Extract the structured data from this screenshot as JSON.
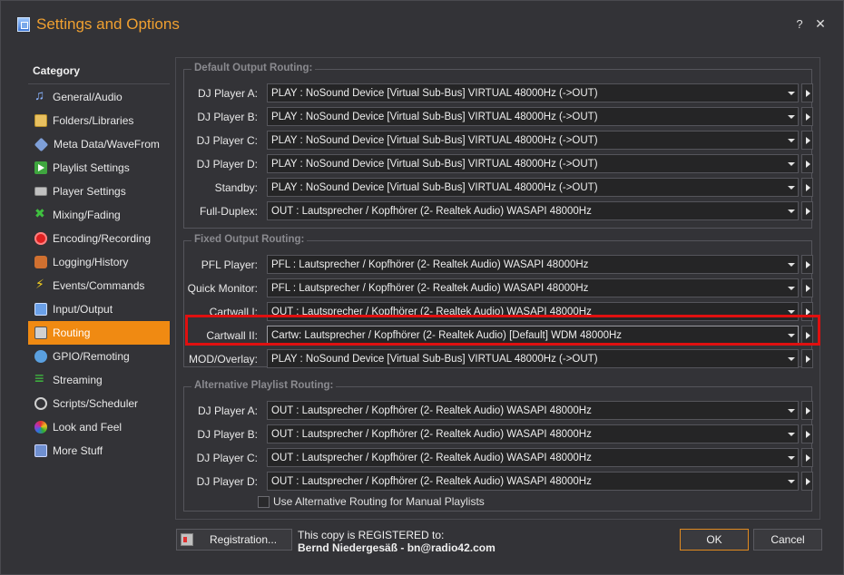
{
  "window": {
    "title": "Settings and Options",
    "help_label": "?",
    "close_label": "✕"
  },
  "sidebar": {
    "title": "Category",
    "active_index": 13,
    "items": [
      {
        "label": "General/Audio",
        "icon": "music-note-icon"
      },
      {
        "label": "Folders/Libraries",
        "icon": "folder-icon"
      },
      {
        "label": "Meta Data/WaveFrom",
        "icon": "metadata-icon"
      },
      {
        "label": "Playlist Settings",
        "icon": "playlist-icon"
      },
      {
        "label": "Player Settings",
        "icon": "player-icon"
      },
      {
        "label": "Mixing/Fading",
        "icon": "mixing-icon"
      },
      {
        "label": "Encoding/Recording",
        "icon": "record-icon"
      },
      {
        "label": "Logging/History",
        "icon": "logbook-icon"
      },
      {
        "label": "Events/Commands",
        "icon": "lightning-icon"
      },
      {
        "label": "Input/Output",
        "icon": "input-output-icon"
      },
      {
        "label": "Routing",
        "icon": "routing-icon"
      },
      {
        "label": "GPIO/Remoting",
        "icon": "gpio-icon"
      },
      {
        "label": "Streaming",
        "icon": "streaming-icon"
      },
      {
        "label": "Scripts/Scheduler",
        "icon": "clock-icon"
      },
      {
        "label": "Look and Feel",
        "icon": "palette-icon"
      },
      {
        "label": "More Stuff",
        "icon": "more-stuff-icon"
      }
    ]
  },
  "default_routing": {
    "legend": "Default Output Routing:",
    "rows": [
      {
        "label": "DJ Player A:",
        "value": "PLAY : NoSound Device [Virtual Sub-Bus] VIRTUAL 48000Hz (->OUT)"
      },
      {
        "label": "DJ Player B:",
        "value": "PLAY : NoSound Device [Virtual Sub-Bus] VIRTUAL 48000Hz (->OUT)"
      },
      {
        "label": "DJ Player C:",
        "value": "PLAY : NoSound Device [Virtual Sub-Bus] VIRTUAL 48000Hz (->OUT)"
      },
      {
        "label": "DJ Player D:",
        "value": "PLAY : NoSound Device [Virtual Sub-Bus] VIRTUAL 48000Hz (->OUT)"
      },
      {
        "label": "Standby:",
        "value": "PLAY : NoSound Device [Virtual Sub-Bus] VIRTUAL 48000Hz (->OUT)"
      },
      {
        "label": "Full-Duplex:",
        "value": "OUT  : Lautsprecher / Kopfhörer (2- Realtek Audio) WASAPI 48000Hz"
      }
    ]
  },
  "fixed_routing": {
    "legend": "Fixed Output Routing:",
    "rows": [
      {
        "label": "PFL Player:",
        "value": "PFL  : Lautsprecher / Kopfhörer (2- Realtek Audio) WASAPI 48000Hz"
      },
      {
        "label": "Quick Monitor:",
        "value": "PFL  : Lautsprecher / Kopfhörer (2- Realtek Audio) WASAPI 48000Hz"
      },
      {
        "label": "Cartwall I:",
        "value": "OUT  : Lautsprecher / Kopfhörer (2- Realtek Audio) WASAPI 48000Hz"
      },
      {
        "label": "Cartwall II:",
        "value": "Cartw: Lautsprecher / Kopfhörer (2- Realtek Audio) [Default] WDM 48000Hz"
      },
      {
        "label": "MOD/Overlay:",
        "value": "PLAY : NoSound Device [Virtual Sub-Bus] VIRTUAL 48000Hz (->OUT)"
      }
    ]
  },
  "alt_routing": {
    "legend": "Alternative Playlist Routing:",
    "rows": [
      {
        "label": "DJ Player A:",
        "value": "OUT  : Lautsprecher / Kopfhörer (2- Realtek Audio) WASAPI 48000Hz"
      },
      {
        "label": "DJ Player B:",
        "value": "OUT  : Lautsprecher / Kopfhörer (2- Realtek Audio) WASAPI 48000Hz"
      },
      {
        "label": "DJ Player C:",
        "value": "OUT  : Lautsprecher / Kopfhörer (2- Realtek Audio) WASAPI 48000Hz"
      },
      {
        "label": "DJ Player D:",
        "value": "OUT  : Lautsprecher / Kopfhörer (2- Realtek Audio) WASAPI 48000Hz"
      }
    ],
    "checkbox_label": "Use Alternative Routing for Manual Playlists",
    "checkbox_checked": false
  },
  "footer": {
    "registration_button": "Registration...",
    "registered_line": "This copy is REGISTERED to:",
    "registered_name": "Bernd Niedergesäß - bn@radio42.com",
    "ok_label": "OK",
    "cancel_label": "Cancel"
  },
  "colors": {
    "accent": "#f08a12",
    "title": "#f0a030",
    "highlight": "#e01010"
  }
}
